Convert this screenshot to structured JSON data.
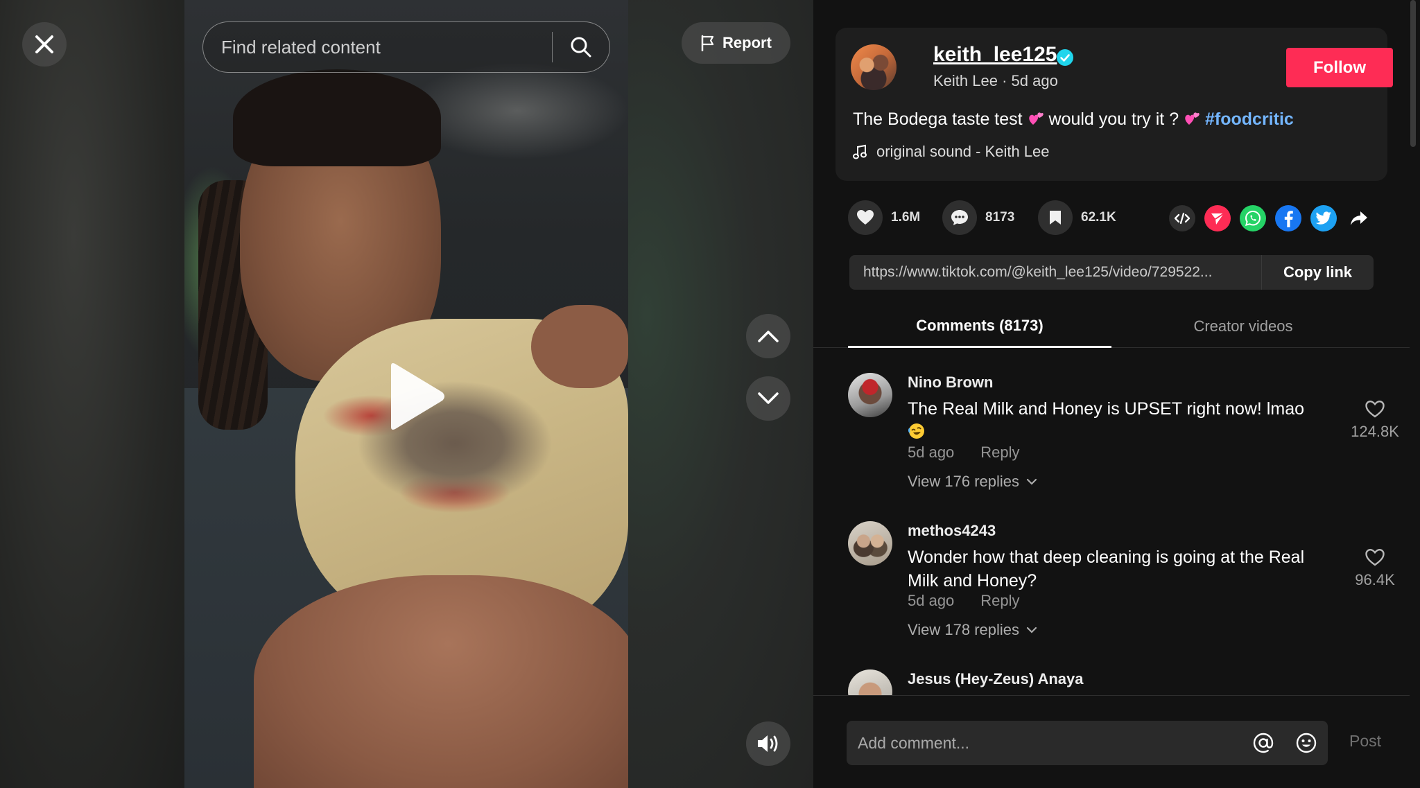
{
  "video": {
    "search_placeholder": "Find related content",
    "report_label": "Report"
  },
  "author": {
    "username": "keith_lee125",
    "display_name": "Keith Lee",
    "separator": " · ",
    "posted": "5d ago",
    "follow_label": "Follow",
    "verified": true
  },
  "post": {
    "description_text": "The Bodega taste test ",
    "description_mid": " would you try it ? ",
    "hashtag": "#foodcritic",
    "sound": "original sound - Keith Lee"
  },
  "stats": {
    "likes": "1.6M",
    "comments": "8173",
    "saves": "62.1K"
  },
  "share": {
    "link": "https://www.tiktok.com/@keith_lee125/video/729522...",
    "copy_label": "Copy link"
  },
  "tabs": [
    {
      "label": "Comments (8173)",
      "active": true
    },
    {
      "label": "Creator videos",
      "active": false
    }
  ],
  "comments": [
    {
      "user": "Nino Brown",
      "text": "The Real Milk and Honey is UPSET right now! lmao",
      "time": "5d ago",
      "reply_label": "Reply",
      "replies_label": "View 176 replies",
      "likes": "124.8K"
    },
    {
      "user": "methos4243",
      "text": "Wonder how that deep cleaning is going at the Real Milk and Honey?",
      "time": "5d ago",
      "reply_label": "Reply",
      "replies_label": "View 178 replies",
      "likes": "96.4K"
    },
    {
      "user": "Jesus (Hey-Zeus) Anaya"
    }
  ],
  "composer": {
    "placeholder": "Add comment...",
    "post_label": "Post"
  },
  "icons": {
    "close": "close-icon",
    "search": "search-icon",
    "report": "flag-icon",
    "play": "play-icon",
    "up": "chevron-up-icon",
    "down": "chevron-down-icon",
    "sound": "volume-icon",
    "like": "heart-icon",
    "comment": "comment-icon",
    "save": "bookmark-icon",
    "embed": "embed-icon",
    "send": "send-icon",
    "whatsapp": "whatsapp-icon",
    "facebook": "facebook-icon",
    "twitter": "twitter-icon",
    "share": "share-arrow-icon",
    "mention": "mention-icon",
    "emoji": "emoji-icon"
  },
  "colors": {
    "accent": "#fe2c55",
    "hashtag": "#74b6ff",
    "verified": "#20d5ec",
    "panel_bg": "#121212"
  }
}
